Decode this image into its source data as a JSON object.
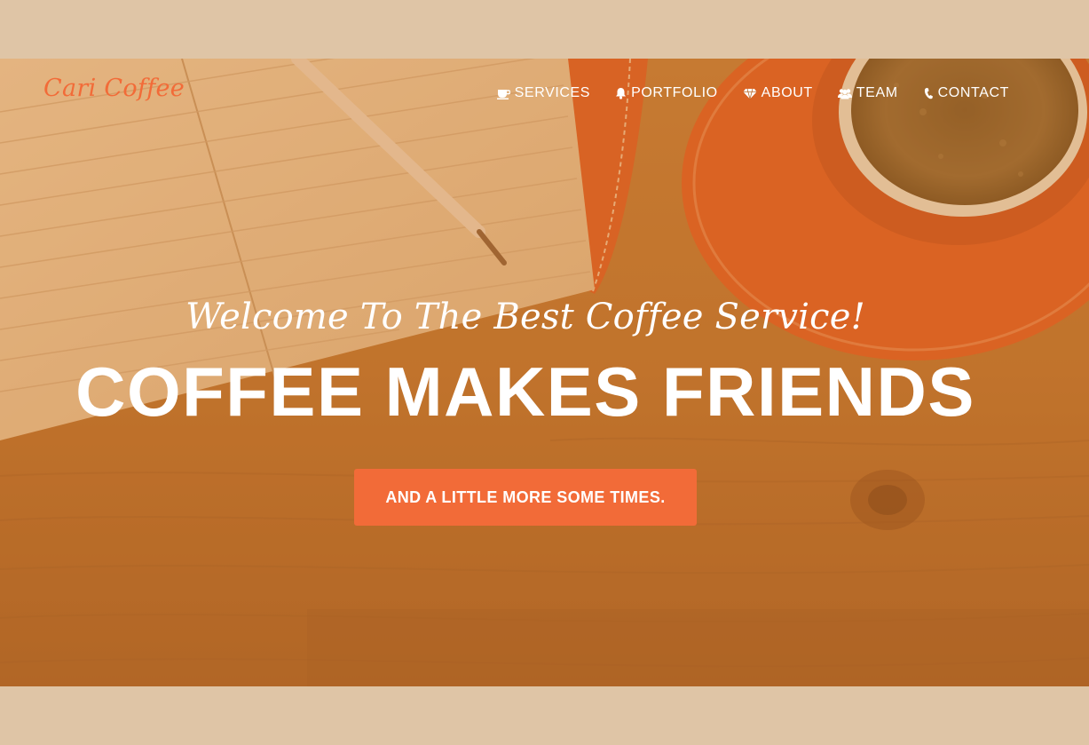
{
  "brand": {
    "name": "Cari Coffee"
  },
  "nav": {
    "items": [
      {
        "label": "SERVICES",
        "icon": "coffee-cup-icon"
      },
      {
        "label": "PORTFOLIO",
        "icon": "bell-icon"
      },
      {
        "label": "ABOUT",
        "icon": "diamond-icon"
      },
      {
        "label": "TEAM",
        "icon": "users-icon"
      },
      {
        "label": "CONTACT",
        "icon": "phone-icon"
      }
    ]
  },
  "hero": {
    "tagline": "Welcome To The Best Coffee Service!",
    "headline": "COFFEE MAKES FRIENDS",
    "cta_label": "AND A LITTLE MORE SOME TIMES."
  },
  "colors": {
    "accent": "#f26b38",
    "page_background": "#dfc5a6",
    "text_on_hero": "#ffffff"
  }
}
